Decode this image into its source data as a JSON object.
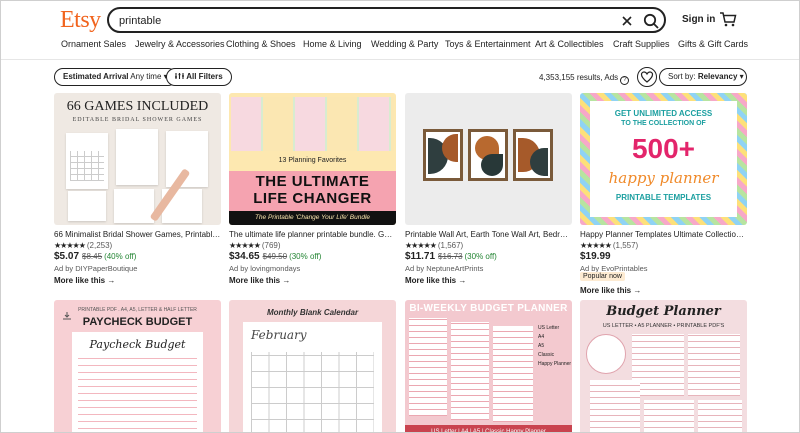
{
  "header": {
    "logo": "Etsy",
    "search_value": "printable",
    "signin": "Sign in"
  },
  "categories": [
    "Ornament Sales",
    "Jewelry & Accessories",
    "Clothing & Shoes",
    "Home & Living",
    "Wedding & Party",
    "Toys & Entertainment",
    "Art & Collectibles",
    "Craft Supplies",
    "Gifts & Gift Cards"
  ],
  "filters": {
    "arrival_label": "Estimated Arrival",
    "arrival_value": "Any time",
    "all_filters": "All Filters",
    "results": "4,353,155 results, Ads",
    "sort_label": "Sort by:",
    "sort_value": "Relevancy"
  },
  "listings": [
    {
      "title": "66 Minimalist Bridal Shower Games, Printable ...",
      "stars": "★★★★★",
      "reviews": "(2,253)",
      "price": "$5.07",
      "original": "$8.45",
      "discount": "(40% off)",
      "seller": "Ad by DIYPaperBoutique",
      "more": "More like this",
      "thumb_text": {
        "head": "66 GAMES INCLUDED",
        "sub": "EDITABLE BRIDAL SHOWER GAMES"
      }
    },
    {
      "title": "The ultimate life planner printable bundle. Get ...",
      "stars": "★★★★★",
      "reviews": "(769)",
      "price": "$34.65",
      "original": "$49.50",
      "discount": "(30% off)",
      "seller": "Ad by lovingmondays",
      "more": "More like this",
      "thumb_text": {
        "tag": "13 Planning Favorites",
        "big1": "THE ULTIMATE",
        "big2": "LIFE CHANGER",
        "banner": "The Printable 'Change Your Life' Bundle"
      }
    },
    {
      "title": "Printable Wall Art, Earth Tone Wall Art, Bedroo...",
      "stars": "★★★★★",
      "reviews": "(1,567)",
      "price": "$11.71",
      "original": "$16.73",
      "discount": "(30% off)",
      "seller": "Ad by NeptuneArtPrints",
      "more": "More like this"
    },
    {
      "title": "Happy Planner Templates Ultimate Collection, ...",
      "stars": "★★★★★",
      "reviews": "(1,557)",
      "price": "$19.99",
      "seller": "Ad by EvoPrintables",
      "badge": "Popular now",
      "more": "More like this",
      "thumb_text": {
        "l1": "GET UNLIMITED ACCESS",
        "l2": "TO THE COLLECTION OF",
        "big": "500+",
        "script": "happy planner",
        "l3": "PRINTABLE TEMPLATES"
      }
    }
  ],
  "row2": [
    {
      "tag": "PRINTABLE PDF . A4, A5, LETTER & HALF LETTER",
      "title": "PAYCHECK BUDGET",
      "script": "Paycheck Budget"
    },
    {
      "title": "Monthly Blank Calendar",
      "script": "February"
    },
    {
      "title": "BI-WEEKLY BUDGET PLANNER",
      "footer": "US Letter | A4 | A5 | Classic Happy Planner",
      "bullets": [
        "US Letter",
        "A4",
        "A5",
        "Classic",
        "Happy Planner"
      ]
    },
    {
      "title": "Budget Planner",
      "sub": "US LETTER • A5 PLANNER • PRINTABLE PDF'S"
    }
  ],
  "colors": {
    "brand": "#F1641E",
    "discount": "#258635",
    "pink": "#F4A6B6"
  }
}
